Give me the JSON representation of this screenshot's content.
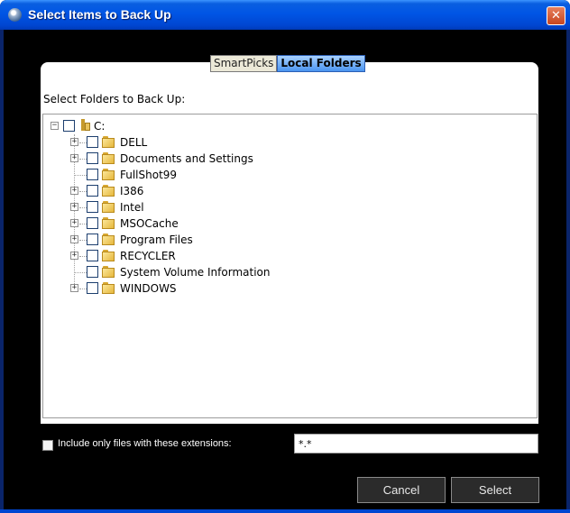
{
  "window": {
    "title": "Select Items to Back Up",
    "close_glyph": "✕"
  },
  "tabs": [
    {
      "label": "SmartPicks",
      "selected": false
    },
    {
      "label": "Local Folders",
      "selected": true
    }
  ],
  "panel": {
    "caption": "Select Folders to Back Up:"
  },
  "tree": {
    "root": {
      "label": "C:",
      "expanded": true,
      "checked": false,
      "icon": "drive-icon"
    },
    "children": [
      {
        "label": "DELL",
        "has_children": true,
        "checked": false,
        "icon": "folder-icon"
      },
      {
        "label": "Documents and Settings",
        "has_children": true,
        "checked": false,
        "icon": "folder-icon"
      },
      {
        "label": "FullShot99",
        "has_children": false,
        "checked": false,
        "icon": "folder-icon"
      },
      {
        "label": "I386",
        "has_children": true,
        "checked": false,
        "icon": "folder-icon"
      },
      {
        "label": "Intel",
        "has_children": true,
        "checked": false,
        "icon": "folder-icon"
      },
      {
        "label": "MSOCache",
        "has_children": true,
        "checked": false,
        "icon": "folder-icon"
      },
      {
        "label": "Program Files",
        "has_children": true,
        "checked": false,
        "icon": "folder-icon"
      },
      {
        "label": "RECYCLER",
        "has_children": true,
        "checked": false,
        "icon": "folder-icon"
      },
      {
        "label": "System Volume Information",
        "has_children": false,
        "checked": false,
        "icon": "folder-icon"
      },
      {
        "label": "WINDOWS",
        "has_children": true,
        "checked": false,
        "icon": "folder-icon"
      }
    ]
  },
  "extensions": {
    "checkbox_label": "Include only files with these extensions:",
    "checked": false,
    "value": "*.*"
  },
  "buttons": {
    "cancel": "Cancel",
    "select": "Select"
  },
  "colors": {
    "titlebar": "#0055e5",
    "background": "#000000",
    "selected_tab": "#4a94f0",
    "close_button": "#c7451f"
  }
}
